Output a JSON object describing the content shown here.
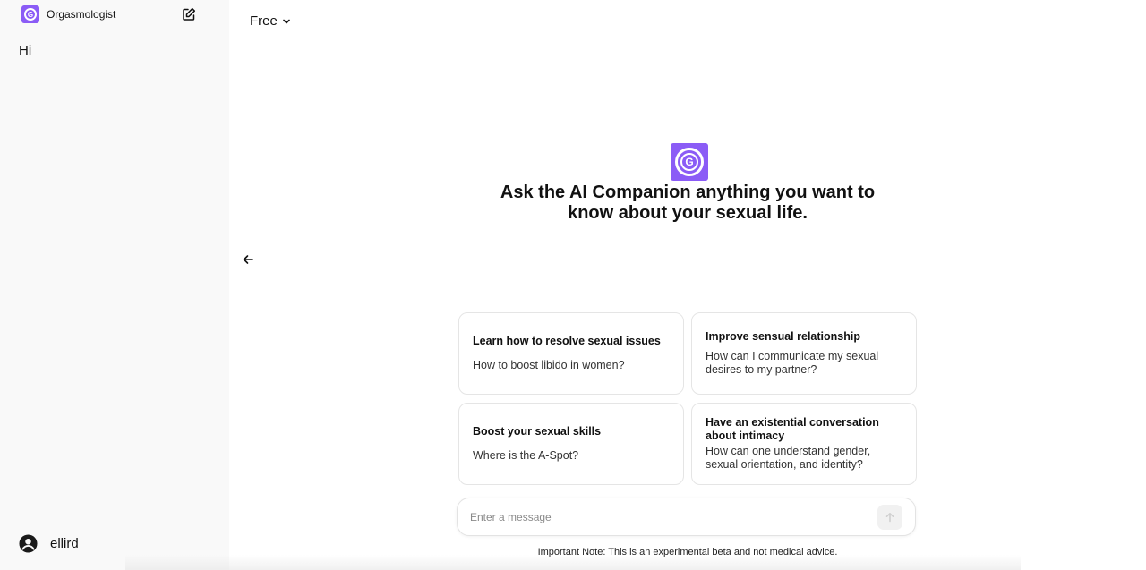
{
  "sidebar": {
    "brand_name": "Orgasmologist",
    "chats": [
      {
        "label": "Hi"
      }
    ],
    "user": {
      "name": "ellird"
    }
  },
  "header": {
    "model_label": "Free"
  },
  "hero": {
    "title": "Ask the AI Companion anything you want to know about your sexual life."
  },
  "suggestions": [
    {
      "title": "Learn how to resolve sexual issues",
      "prompt": "How to boost libido in women?"
    },
    {
      "title": "Improve sensual relationship",
      "prompt": "How can I communicate my sexual desires to my partner?"
    },
    {
      "title": "Boost your sexual skills",
      "prompt": "Where is the A-Spot?"
    },
    {
      "title": "Have an existential conversation about intimacy",
      "prompt": "How can one understand gender, sexual orientation, and identity?"
    }
  ],
  "composer": {
    "placeholder": "Enter a message",
    "value": ""
  },
  "footer": {
    "note": "Important Note: This is an experimental beta and not medical advice."
  },
  "colors": {
    "brand": "#8b5cf6",
    "sidebar_bg": "#f9f9f9"
  },
  "icons": {
    "new_chat": "edit-icon",
    "model_dropdown": "chevron-down-icon",
    "collapse": "arrow-left-icon",
    "user": "user-circle-icon",
    "send": "arrow-up-icon"
  }
}
